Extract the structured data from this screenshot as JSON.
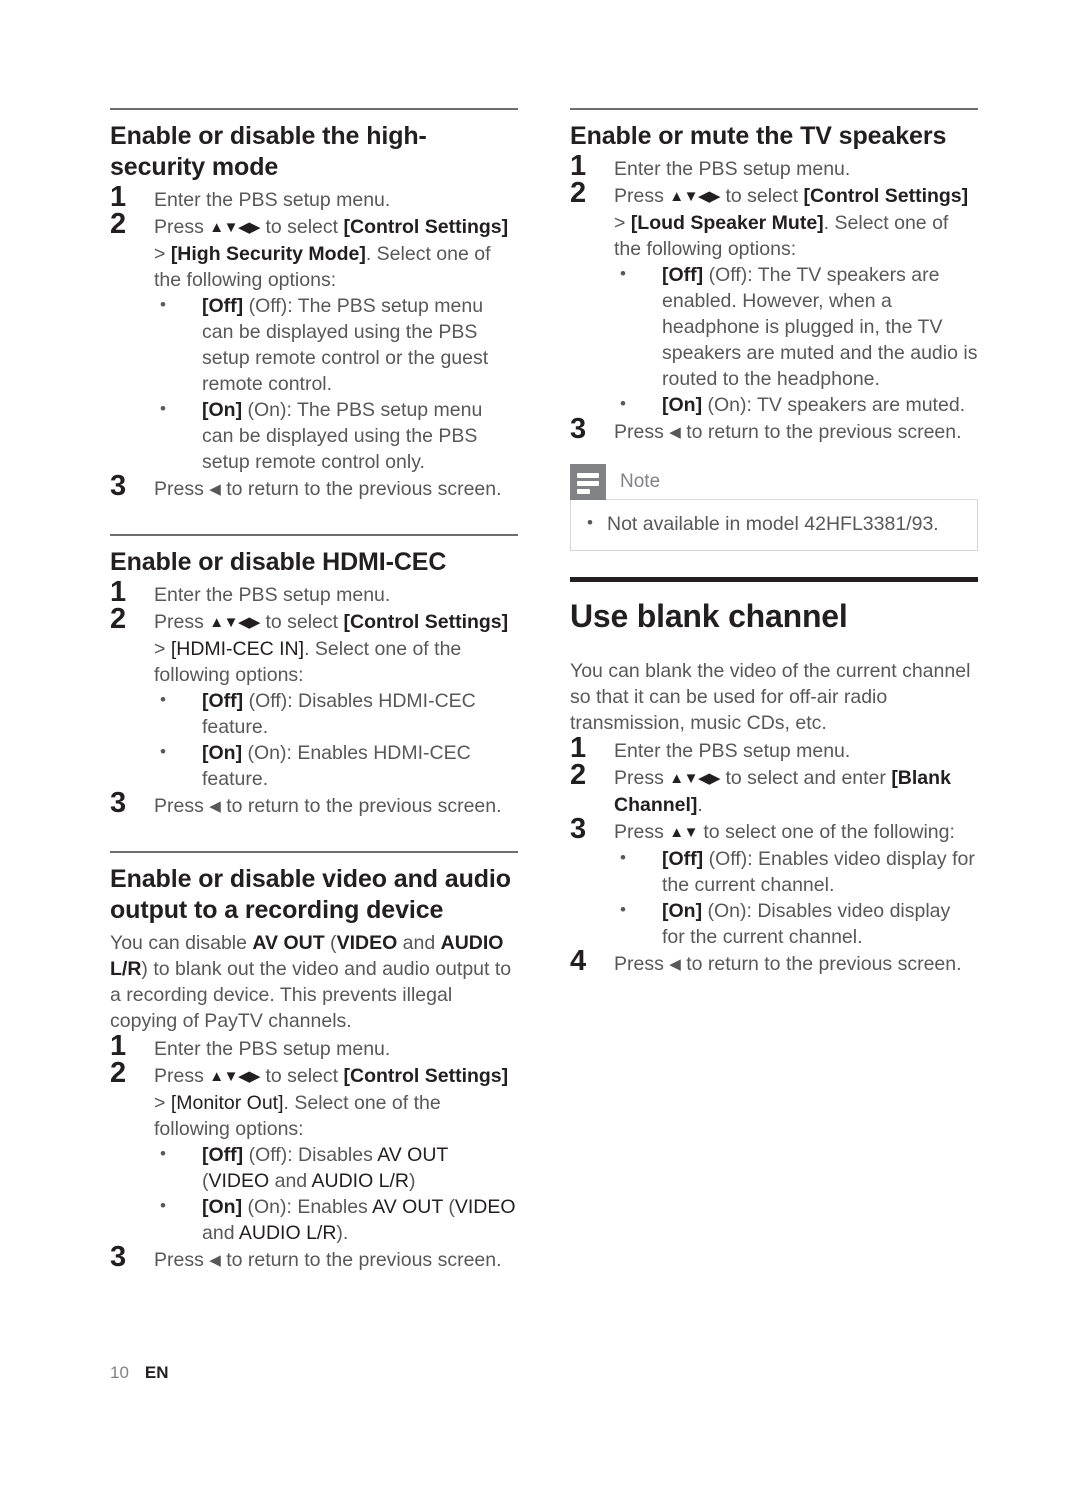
{
  "page": {
    "footer_page_number": "10",
    "footer_language": "EN",
    "colors": {
      "body_text": "#58585a",
      "heading_text": "#231f20",
      "section_rule": "#6d6e70",
      "chapter_rule": "#231f20",
      "note_icon_bg": "#808285",
      "note_border": "#d6d7d8"
    }
  },
  "left_column": {
    "sections": [
      {
        "title": "Enable or disable the high-security mode",
        "rule": "section",
        "steps": [
          {
            "num": "1",
            "text": "Enter the PBS setup menu."
          },
          {
            "num": "2",
            "text_pre": "Press ",
            "arrows": "▲▼◀▶",
            "text_mid": " to select ",
            "bracket1": "[Control Settings]",
            "text_sep": " > ",
            "bracket2": "[High Security Mode]",
            "text_post": ". Select one of the following options:",
            "options": [
              {
                "bracket": "[Off]",
                "paren": "(Off)",
                "desc": ": The PBS setup menu can be displayed using the PBS setup remote control or the guest remote control."
              },
              {
                "bracket": "[On]",
                "paren": "(On)",
                "desc": ": The PBS setup menu can be displayed using the PBS setup remote control only."
              }
            ]
          },
          {
            "num": "3",
            "text_pre": "Press ",
            "arrow": "◀",
            "text_post": " to return to the previous screen."
          }
        ]
      },
      {
        "title": "Enable or disable HDMI-CEC",
        "rule": "section",
        "steps": [
          {
            "num": "1",
            "text": "Enter the PBS setup menu."
          },
          {
            "num": "2",
            "text_pre": "Press ",
            "arrows": "▲▼◀▶",
            "text_mid": " to select ",
            "bracket1": "[Control Settings]",
            "text_sep": " > ",
            "bracket2": "[HDMI-CEC IN]",
            "text_post": ". Select one of the following options:",
            "options": [
              {
                "bracket": "[Off]",
                "paren": "(Off)",
                "desc": ": Disables HDMI-CEC feature."
              },
              {
                "bracket": "[On]",
                "paren": "(On)",
                "desc": ": Enables HDMI-CEC feature."
              }
            ]
          },
          {
            "num": "3",
            "text_pre": "Press ",
            "arrow": "◀",
            "text_post": " to return to the previous screen."
          }
        ]
      },
      {
        "title": "Enable or disable video and audio output to a recording device",
        "rule": "section",
        "intro_pre": "You can disable ",
        "intro_kw1": "AV OUT",
        "intro_mid1": " (",
        "intro_kw2": "VIDEO",
        "intro_mid2": " and ",
        "intro_kw3": "AUDIO L/R",
        "intro_post": ") to blank out the video and audio output to a recording device. This prevents illegal copying of PayTV channels.",
        "steps": [
          {
            "num": "1",
            "text": "Enter the PBS setup menu."
          },
          {
            "num": "2",
            "text_pre": "Press ",
            "arrows": "▲▼◀▶",
            "text_mid": " to select ",
            "bracket1": "[Control Settings]",
            "text_sep": " > ",
            "bracket2": "[Monitor Out]",
            "text_post": ". Select one of the following options:",
            "options": [
              {
                "bracket": "[Off]",
                "paren": "(Off)",
                "desc_pre": ": Disables ",
                "kw1": "AV OUT",
                "desc_mid1": " (",
                "kw2": "VIDEO",
                "desc_mid2": " and ",
                "kw3": "AUDIO L/R",
                "desc_post": ")"
              },
              {
                "bracket": "[On]",
                "paren": "(On)",
                "desc_pre": ": Enables ",
                "kw1": "AV OUT",
                "desc_mid1": " (",
                "kw2": "VIDEO",
                "desc_mid2": " and ",
                "kw3": "AUDIO L/R",
                "desc_post": ")."
              }
            ]
          },
          {
            "num": "3",
            "text_pre": "Press ",
            "arrow": "◀",
            "text_post": " to return to the previous screen."
          }
        ]
      }
    ]
  },
  "right_column": {
    "sections": [
      {
        "title": "Enable or mute the TV speakers",
        "rule": "section",
        "steps": [
          {
            "num": "1",
            "text": "Enter the PBS setup menu."
          },
          {
            "num": "2",
            "text_pre": "Press ",
            "arrows": "▲▼◀▶",
            "text_mid": " to select ",
            "bracket1": "[Control Settings]",
            "text_sep": " > ",
            "bracket2": "[Loud Speaker Mute]",
            "text_post": ". Select one of the following options:",
            "options": [
              {
                "bracket": "[Off]",
                "paren": "(Off)",
                "desc": ": The TV speakers are enabled. However, when a headphone is plugged in, the TV speakers are muted and the audio is routed to the headphone."
              },
              {
                "bracket": "[On]",
                "paren": "(On)",
                "desc": ": TV speakers are muted."
              }
            ]
          },
          {
            "num": "3",
            "text_pre": "Press ",
            "arrow": "◀",
            "text_post": " to return to the previous screen."
          }
        ],
        "note": {
          "label": "Note",
          "items": [
            "Not available in model 42HFL3381/93."
          ]
        }
      }
    ],
    "chapter": {
      "title": "Use blank channel",
      "rule": "chapter",
      "intro": "You can blank the video of the current channel so that it can be used for off-air radio transmission, music CDs, etc.",
      "steps": [
        {
          "num": "1",
          "text": "Enter the PBS setup menu."
        },
        {
          "num": "2",
          "text_pre": "Press ",
          "arrows": "▲▼◀▶",
          "text_mid": " to select and enter ",
          "bracket1": "[Blank Channel]",
          "text_post": "."
        },
        {
          "num": "3",
          "text_pre": "Press ",
          "arrows": "▲▼",
          "text_post": " to select one of the following:",
          "options": [
            {
              "bracket": "[Off]",
              "paren": "(Off)",
              "desc": ": Enables video display for the current channel."
            },
            {
              "bracket": "[On]",
              "paren": "(On)",
              "desc": ": Disables video display for the current channel."
            }
          ]
        },
        {
          "num": "4",
          "text_pre": "Press ",
          "arrow": "◀",
          "text_post": " to return to the previous screen."
        }
      ]
    }
  }
}
